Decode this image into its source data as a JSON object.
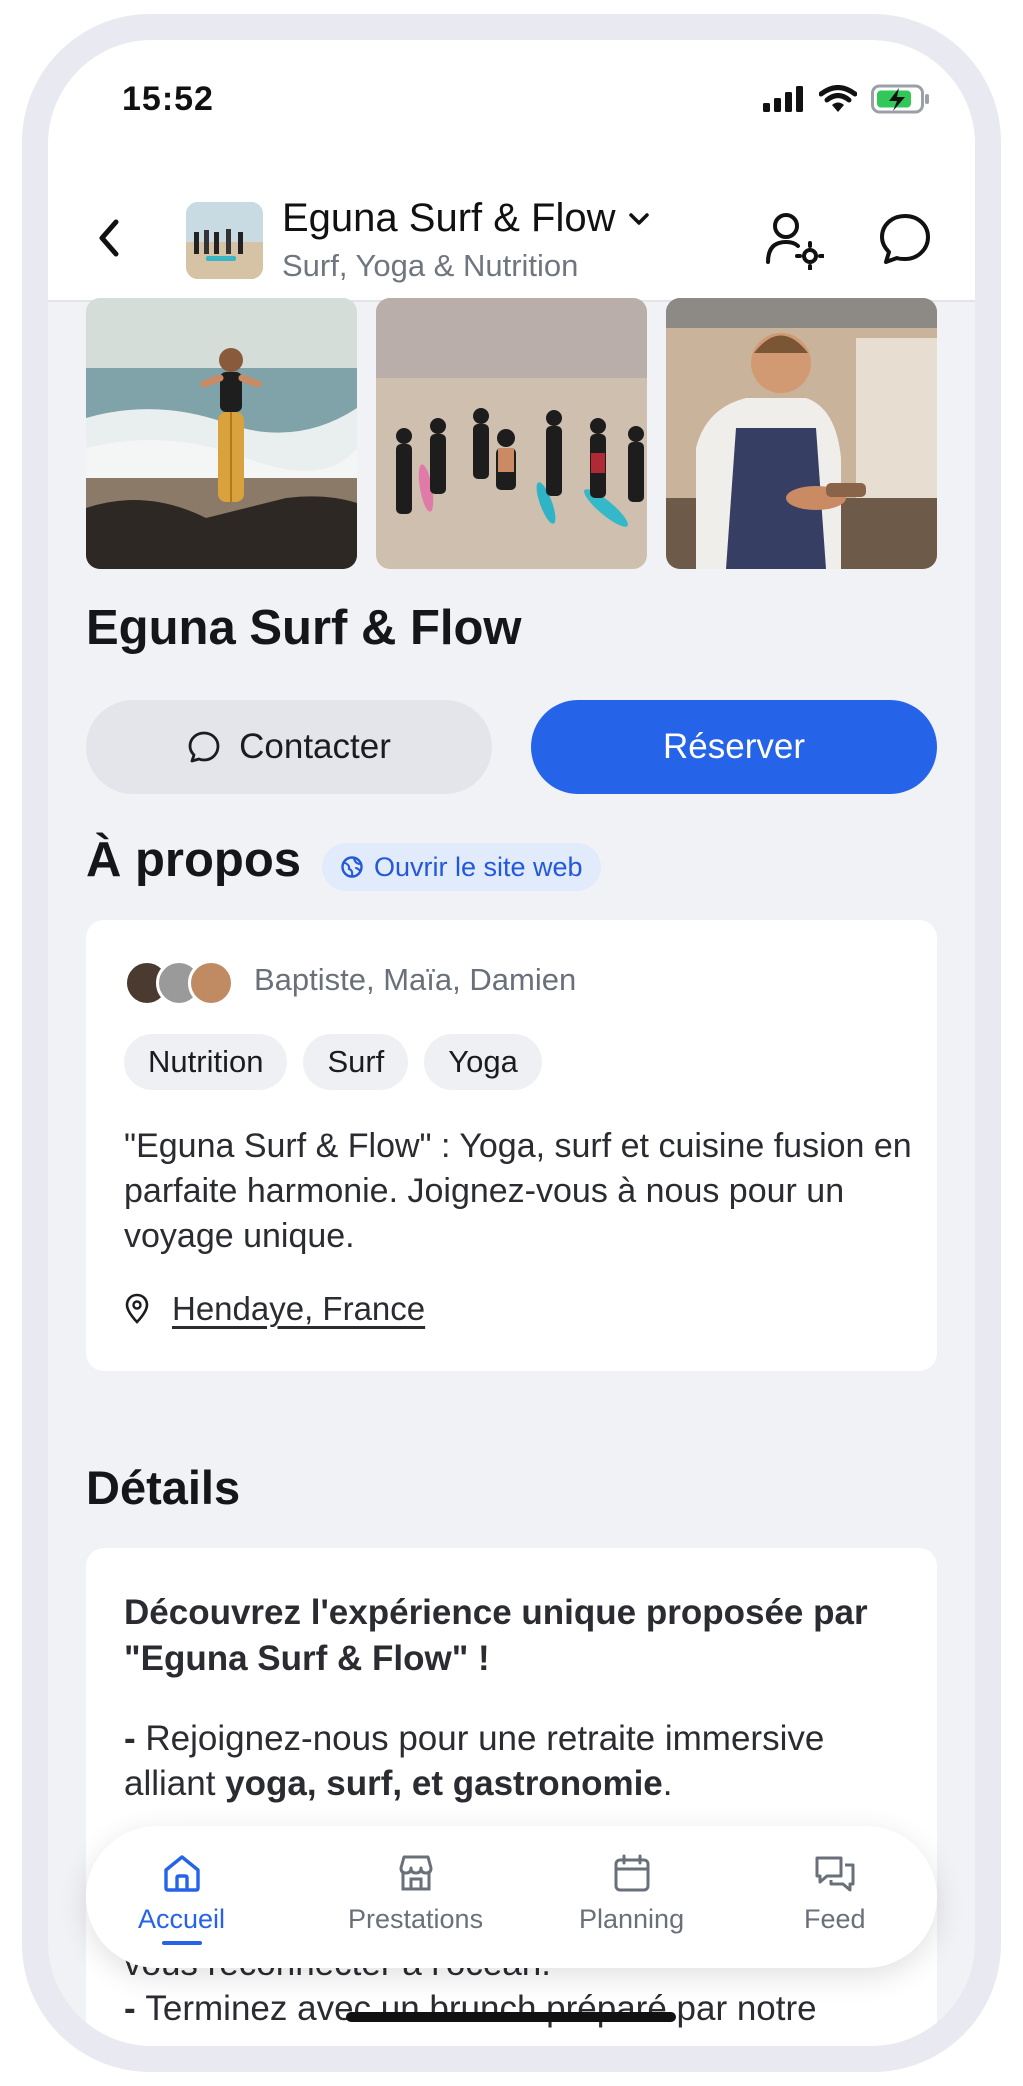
{
  "status_bar": {
    "time": "15:52"
  },
  "header": {
    "title": "Eguna Surf & Flow",
    "subtitle": "Surf, Yoga & Nutrition"
  },
  "page": {
    "title": "Eguna Surf & Flow",
    "contact_label": "Contacter",
    "reserve_label": "Réserver"
  },
  "about": {
    "heading": "À propos",
    "website_label": "Ouvrir le site web",
    "team": "Baptiste, Maïa, Damien",
    "tags": [
      "Nutrition",
      "Surf",
      "Yoga"
    ],
    "description": "\"Eguna Surf & Flow\" : Yoga, surf et cuisine fusion en parfaite harmonie. Joignez-vous à nous pour un voyage unique.",
    "location": "Hendaye, France"
  },
  "details": {
    "heading": "Détails",
    "headline": "Découvrez l'expérience unique proposée par \"Eguna Surf & Flow\" !",
    "line1_prefix": "- ",
    "line1_a": "Rejoignez-nous pour une retraite immersive alliant ",
    "line1_bold": "yoga, surf, et gastronomie",
    "line1_end": ".",
    "line2": "vous reconnecter à l'océan.",
    "line3_prefix": "- ",
    "line3": "Terminez avec un brunch préparé par notre"
  },
  "tabbar": {
    "tabs": [
      {
        "label": "Accueil",
        "icon": "home-icon",
        "active": true
      },
      {
        "label": "Prestations",
        "icon": "store-icon",
        "active": false
      },
      {
        "label": "Planning",
        "icon": "calendar-icon",
        "active": false
      },
      {
        "label": "Feed",
        "icon": "chat-bubbles-icon",
        "active": false
      }
    ]
  },
  "colors": {
    "accent": "#2563e8",
    "background": "#f1f2f5"
  }
}
